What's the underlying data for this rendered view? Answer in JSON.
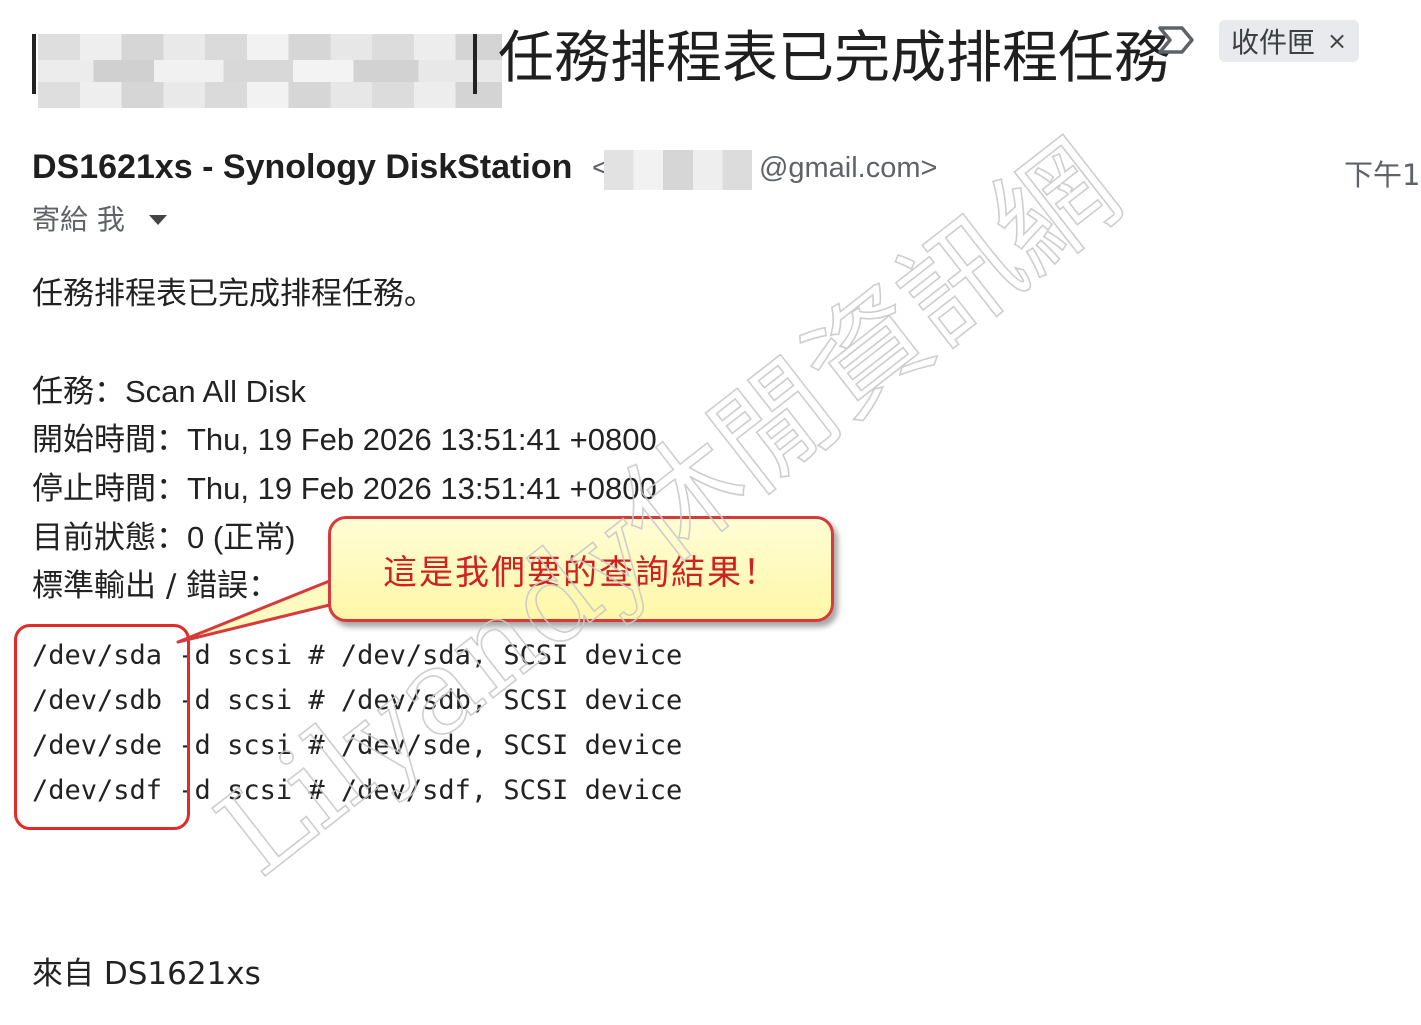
{
  "subject": {
    "title": "任務排程表已完成排程任務",
    "label_chip": "收件匣",
    "label_chip_close": "×"
  },
  "sender": {
    "name": "DS1621xs - Synology DiskStation",
    "email_open": "<",
    "email_suffix": "@gmail.com>",
    "time": "下午1:"
  },
  "recipient": {
    "text": "寄給 我"
  },
  "body": {
    "intro": "任務排程表已完成排程任務。",
    "task_label": "任務：",
    "task_value": "Scan All Disk",
    "start_label": "開始時間：",
    "start_value": "Thu, 19 Feb 2026 13:51:41 +0800",
    "stop_label": "停止時間：",
    "stop_value": "Thu, 19 Feb 2026 13:51:41 +0800",
    "status_label": "目前狀態：",
    "status_value": "0 (正常)",
    "output_label": "標準輸出 / 錯誤：",
    "output_lines": [
      "/dev/sda -d scsi # /dev/sda, SCSI device",
      "/dev/sdb -d scsi # /dev/sdb, SCSI device",
      "/dev/sde -d scsi # /dev/sde, SCSI device",
      "/dev/sdf -d scsi # /dev/sdf, SCSI device"
    ],
    "footer": "來自 DS1621xs"
  },
  "annotation": {
    "callout_text": "這是我們要的查詢結果！"
  },
  "watermark": {
    "text": "Lilyandy休閒資訊網"
  },
  "colors": {
    "callout_border": "#d63a3a",
    "callout_fill": "#fff7a8",
    "highlight_box": "#e32a2a",
    "chip_bg": "#e8eaed"
  }
}
